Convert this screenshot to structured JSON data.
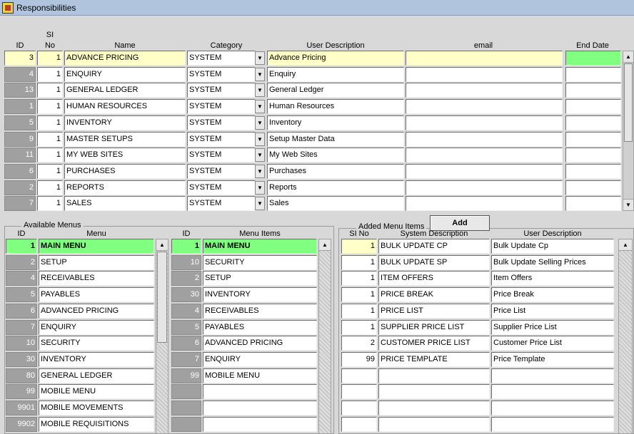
{
  "window": {
    "title": "Responsibilities"
  },
  "resp": {
    "headers": {
      "id": "ID",
      "si_line1": "SI",
      "si_line2": "No",
      "name": "Name",
      "category": "Category",
      "user_desc": "User Description",
      "email": "email",
      "end_date": "End Date"
    },
    "rows": [
      {
        "id": "3",
        "si": "1",
        "name": "ADVANCE PRICING",
        "category": "SYSTEM",
        "desc": "Advance Pricing",
        "email": "",
        "end": ""
      },
      {
        "id": "4",
        "si": "1",
        "name": "ENQUIRY",
        "category": "SYSTEM",
        "desc": "Enquiry",
        "email": "",
        "end": ""
      },
      {
        "id": "13",
        "si": "1",
        "name": "GENERAL LEDGER",
        "category": "SYSTEM",
        "desc": "General Ledger",
        "email": "",
        "end": ""
      },
      {
        "id": "1",
        "si": "1",
        "name": "HUMAN RESOURCES",
        "category": "SYSTEM",
        "desc": "Human Resources",
        "email": "",
        "end": ""
      },
      {
        "id": "5",
        "si": "1",
        "name": "INVENTORY",
        "category": "SYSTEM",
        "desc": "Inventory",
        "email": "",
        "end": ""
      },
      {
        "id": "9",
        "si": "1",
        "name": "MASTER SETUPS",
        "category": "SYSTEM",
        "desc": "Setup Master Data",
        "email": "",
        "end": ""
      },
      {
        "id": "11",
        "si": "1",
        "name": "MY WEB SITES",
        "category": "SYSTEM",
        "desc": "My Web Sites",
        "email": "",
        "end": ""
      },
      {
        "id": "6",
        "si": "1",
        "name": "PURCHASES",
        "category": "SYSTEM",
        "desc": "Purchases",
        "email": "",
        "end": ""
      },
      {
        "id": "2",
        "si": "1",
        "name": "REPORTS",
        "category": "SYSTEM",
        "desc": "Reports",
        "email": "",
        "end": ""
      },
      {
        "id": "7",
        "si": "1",
        "name": "SALES",
        "category": "SYSTEM",
        "desc": "Sales",
        "email": "",
        "end": ""
      }
    ]
  },
  "available_menus": {
    "group_label": "Available Menus",
    "headers": {
      "id": "ID",
      "menu": "Menu"
    },
    "rows": [
      {
        "id": "1",
        "menu": "MAIN MENU"
      },
      {
        "id": "2",
        "menu": "SETUP"
      },
      {
        "id": "4",
        "menu": "RECEIVABLES"
      },
      {
        "id": "5",
        "menu": "PAYABLES"
      },
      {
        "id": "6",
        "menu": "ADVANCED PRICING"
      },
      {
        "id": "7",
        "menu": "ENQUIRY"
      },
      {
        "id": "10",
        "menu": "SECURITY"
      },
      {
        "id": "30",
        "menu": "INVENTORY"
      },
      {
        "id": "80",
        "menu": "GENERAL LEDGER"
      },
      {
        "id": "99",
        "menu": "MOBILE MENU"
      },
      {
        "id": "9901",
        "menu": "MOBILE MOVEMENTS"
      },
      {
        "id": "9902",
        "menu": "MOBILE REQUISITIONS"
      }
    ]
  },
  "menu_items": {
    "headers": {
      "id": "ID",
      "item": "Menu Items"
    },
    "rows": [
      {
        "id": "1",
        "item": "MAIN MENU"
      },
      {
        "id": "10",
        "item": "SECURITY"
      },
      {
        "id": "2",
        "item": "SETUP"
      },
      {
        "id": "30",
        "item": "INVENTORY"
      },
      {
        "id": "4",
        "item": "RECEIVABLES"
      },
      {
        "id": "5",
        "item": "PAYABLES"
      },
      {
        "id": "6",
        "item": "ADVANCED PRICING"
      },
      {
        "id": "7",
        "item": "ENQUIRY"
      },
      {
        "id": "99",
        "item": "MOBILE MENU"
      },
      {
        "id": "",
        "item": ""
      },
      {
        "id": "",
        "item": ""
      },
      {
        "id": "",
        "item": ""
      }
    ]
  },
  "added_items": {
    "group_label": "Added Menu Items",
    "add_button": "Add",
    "headers": {
      "si": "SI No",
      "sys_desc": "System Description",
      "user_desc": "User Description"
    },
    "rows": [
      {
        "si": "1",
        "sys": "BULK UPDATE CP",
        "user": "Bulk Update Cp"
      },
      {
        "si": "1",
        "sys": "BULK UPDATE SP",
        "user": "Bulk Update Selling Prices"
      },
      {
        "si": "1",
        "sys": "ITEM OFFERS",
        "user": "Item Offers"
      },
      {
        "si": "1",
        "sys": "PRICE BREAK",
        "user": "Price Break"
      },
      {
        "si": "1",
        "sys": "PRICE LIST",
        "user": "Price List"
      },
      {
        "si": "1",
        "sys": "SUPPLIER PRICE LIST",
        "user": "Supplier Price List"
      },
      {
        "si": "2",
        "sys": "CUSTOMER PRICE LIST",
        "user": "Customer Price List"
      },
      {
        "si": "99",
        "sys": "PRICE TEMPLATE",
        "user": "Price Template"
      },
      {
        "si": "",
        "sys": "",
        "user": ""
      },
      {
        "si": "",
        "sys": "",
        "user": ""
      },
      {
        "si": "",
        "sys": "",
        "user": ""
      },
      {
        "si": "",
        "sys": "",
        "user": ""
      }
    ]
  },
  "icons": {
    "app": "app-icon",
    "dropdown": "chevron-down-icon",
    "scroll_up": "arrow-up-icon",
    "scroll_down": "arrow-down-icon"
  },
  "colors": {
    "highlight_green": "#80ff80",
    "current_row": "#ffffc8",
    "title_bar": "#b0c4de",
    "id_cell": "#a0a0a0"
  }
}
